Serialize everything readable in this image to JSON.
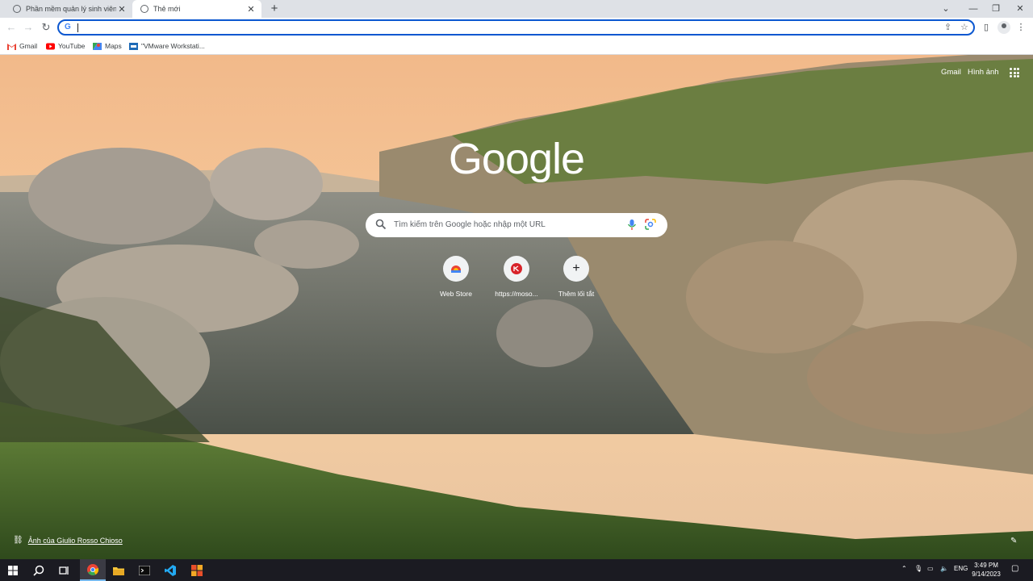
{
  "tabs": [
    {
      "title": "Phần mềm quản lý sinh viên Bac",
      "active": false
    },
    {
      "title": "Thẻ mới",
      "active": true
    }
  ],
  "icons": {
    "new_tab": "plus-icon",
    "minimize": "minimize-icon",
    "restore": "restore-icon",
    "close": "close-icon"
  },
  "toolbar": {
    "back": "back-icon",
    "forward": "forward-icon",
    "reload": "reload-icon",
    "omnibox_value": "",
    "share": "share-icon",
    "bookmark_star": "star-icon",
    "side_panel": "side-panel-icon",
    "profile": "profile-icon",
    "menu": "more-vert-icon"
  },
  "bookmarks": [
    {
      "label": "Gmail",
      "icon": "gmail-icon"
    },
    {
      "label": "YouTube",
      "icon": "youtube-icon"
    },
    {
      "label": "Maps",
      "icon": "maps-icon"
    },
    {
      "label": "\"VMware Workstati...",
      "icon": "vmware-icon"
    }
  ],
  "ntp": {
    "gmail_link": "Gmail",
    "images_link": "Hình ảnh",
    "logo": "Google",
    "search_placeholder": "Tìm kiếm trên Google hoặc nhập một URL",
    "shortcuts": [
      {
        "label": "Web Store",
        "icon": "webstore-icon"
      },
      {
        "label": "https://moso...",
        "icon": "moso-icon"
      },
      {
        "label": "Thêm lối tắt",
        "icon": "plus-icon"
      }
    ],
    "credit": "Ảnh của Giulio Rosso Chioso"
  },
  "taskbar": {
    "apps": [
      "windows-start-icon",
      "search-icon",
      "task-view-icon",
      "chrome-icon",
      "file-explorer-icon",
      "terminal-icon",
      "vscode-icon",
      "codeblocks-icon"
    ],
    "language": "ENG",
    "time": "3:49 PM",
    "date": "9/14/2023"
  },
  "colors": {
    "tabstrip_bg": "#dee1e6",
    "omnibox_focus": "#0b57d0",
    "taskbar_bg": "#1b1b22"
  }
}
